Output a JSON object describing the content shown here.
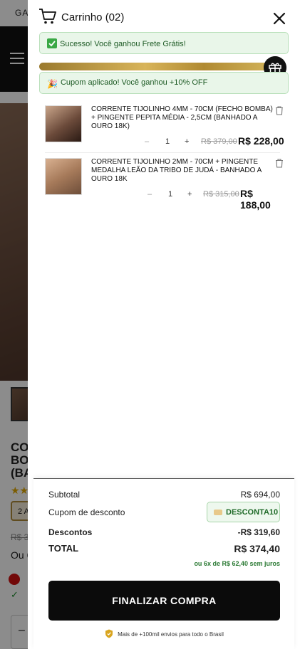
{
  "background": {
    "topbar_text": "GAN",
    "title": "CO\nBO\n(BA",
    "stars": "★★",
    "chip": "2 A",
    "old_price": "R$ 3",
    "ou_text": "Ou 6",
    "qty_minus": "–"
  },
  "cart": {
    "title": "Carrinho (02)",
    "alerts": {
      "shipping": "Sucesso! Você ganhou Frete Grátis!",
      "coupon": "Cupom aplicado! Você ganhou +10% OFF"
    },
    "progress": 0.91,
    "items": [
      {
        "name": "CORRENTE TIJOLINHO 4MM - 70CM (FECHO BOMBA) + PINGENTE PEPITA MÉDIA - 2,5CM (BANHADO A OURO 18K)",
        "qty_minus": "–",
        "qty": "1",
        "qty_plus": "+",
        "old_price": "R$ 379,00",
        "price": "R$ 228,00"
      },
      {
        "name": "CORRENTE TIJOLINHO 2MM - 70CM + PINGENTE MEDALHA LEÃO DA TRIBO DE JUDÁ - BANHADO A OURO 18K",
        "qty_minus": "–",
        "qty": "1",
        "qty_plus": "+",
        "old_price": "R$ 315,00",
        "price": "R$ 188,00"
      }
    ]
  },
  "summary": {
    "subtotal_label": "Subtotal",
    "subtotal_value": "R$ 694,00",
    "coupon_label": "Cupom de desconto",
    "coupon_code": "DESCONTA10",
    "discounts_label": "Descontos",
    "discounts_value": "-R$ 319,60",
    "total_label": "TOTAL",
    "total_value": "R$ 374,40",
    "installments": "ou 6x de R$ 62,40 sem juros",
    "checkout_label": "FINALIZAR COMPRA",
    "trust_text": "Mais de +100mil envios para todo o Brasil"
  },
  "colors": {
    "accent_gold": "#c9a54e",
    "success_green": "#1d5a24",
    "button_black": "#0b0b0b"
  },
  "icons": [
    "cart-icon",
    "close-icon",
    "check-icon",
    "party-icon",
    "gift-icon",
    "trash-icon",
    "coupon-icon",
    "shield-icon",
    "hamburger-icon"
  ]
}
